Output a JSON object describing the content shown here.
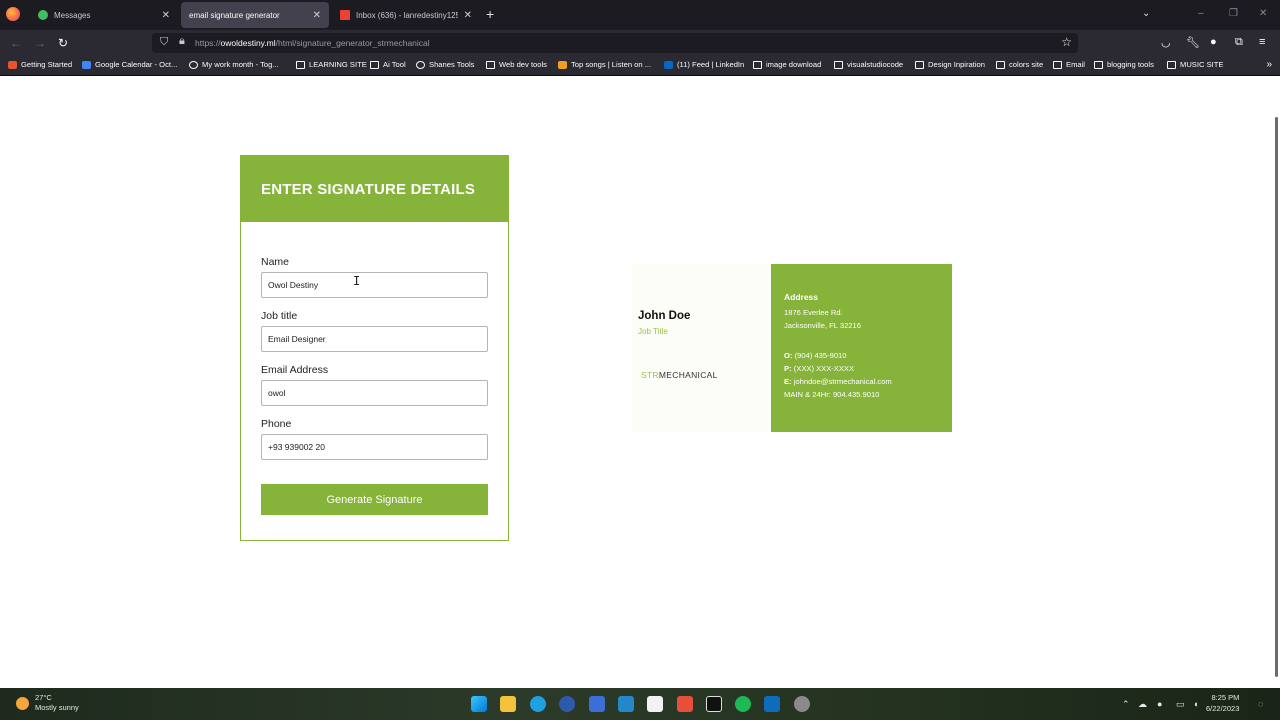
{
  "browser": {
    "tabs": [
      {
        "title": "Messages",
        "active": false
      },
      {
        "title": "email signature generator",
        "active": true
      },
      {
        "title": "Inbox (636) - lanredestiny125@...",
        "active": false
      }
    ],
    "url_domain": "owoldestiny.ml",
    "url_prefix": "https://",
    "url_path": "/html/signature_generator_strmechanical",
    "bookmarks": [
      "Getting Started",
      "Google Calendar - Oct...",
      "My work month - Tog...",
      "LEARNING SITE",
      "Ai Tool",
      "Shanes Tools",
      "Web dev tools",
      "Top songs | Listen on ...",
      "(11) Feed | LinkedIn",
      "image download",
      "visualstudiocode",
      "Design Inpiration",
      "colors site",
      "Email",
      "blogging tools",
      "MUSIC SITE"
    ]
  },
  "form": {
    "heading": "ENTER SIGNATURE DETAILS",
    "name_label": "Name",
    "name_value": "Owol Destiny",
    "job_label": "Job title",
    "job_value": "Email Designer",
    "email_label": "Email Address",
    "email_value": "owol",
    "phone_label": "Phone",
    "phone_value": "+93 939002 20",
    "submit_label": "Generate Signature"
  },
  "signature": {
    "name": "John Doe",
    "job_title": "Job Title",
    "logo_accent": "STR",
    "logo_rest": "MECHANICAL",
    "address_heading": "Address",
    "address_line1": "1876 Everlee Rd.",
    "address_line2": "Jacksonville, FL 32216",
    "office_label": "O:",
    "office_value": "(904) 435-9010",
    "phone_label": "P:",
    "phone_value": "(XXX) XXX-XXXX",
    "email_label": "E:",
    "email_value": "johndoe@strmechanical.com",
    "main_line": "MAIN & 24Hr: 904.435.9010"
  },
  "taskbar": {
    "temperature": "27°C",
    "weather": "Mostly sunny",
    "time": "8:25 PM",
    "date": "6/22/2023"
  },
  "colors": {
    "accent_green": "#86b339",
    "light_green": "#9cc24d"
  }
}
